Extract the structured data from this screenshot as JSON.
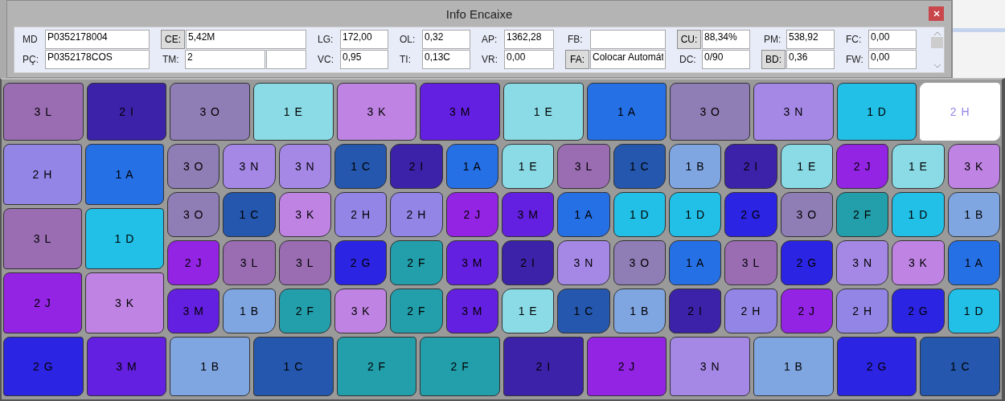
{
  "window": {
    "title": "Info Encaixe"
  },
  "field_columns": [
    [
      {
        "kind": "label",
        "label": "MD",
        "value": "P0352178004"
      },
      {
        "kind": "label",
        "label": "PÇ:",
        "value": "P0352178COS"
      }
    ],
    [
      {
        "kind": "button",
        "label": "CE:",
        "value": "5,42M"
      },
      {
        "kind": "label",
        "label": "TM:",
        "value": "2"
      }
    ],
    [
      {
        "kind": "label",
        "label": "LG:",
        "value": "172,00"
      },
      {
        "kind": "label",
        "label": "VC:",
        "value": "0,95"
      }
    ],
    [
      {
        "kind": "label",
        "label": "OL:",
        "value": "0,32"
      },
      {
        "kind": "label",
        "label": "TI:",
        "value": "0,13C"
      }
    ],
    [
      {
        "kind": "label",
        "label": "AP:",
        "value": "1362,28"
      },
      {
        "kind": "label",
        "label": "VR:",
        "value": "0,00"
      }
    ],
    [
      {
        "kind": "label",
        "label": "FB:"
      },
      {
        "kind": "button",
        "label": "FA:",
        "value": "Colocar Automát"
      }
    ],
    [
      {
        "kind": "button",
        "label": "CU:",
        "value": "88,34%"
      },
      {
        "kind": "label",
        "label": "DC:",
        "value": "0/90"
      }
    ],
    [
      {
        "kind": "label",
        "label": "PM:",
        "value": "538,92"
      },
      {
        "kind": "button",
        "label": "BD:",
        "value": "0,36"
      }
    ],
    [
      {
        "kind": "label",
        "label": "FC:",
        "value": "0,00"
      },
      {
        "kind": "label",
        "label": "FW:",
        "value": "0,00"
      }
    ]
  ],
  "marker": {
    "top_row": [
      {
        "label": "3 L",
        "color": "#9a6db3",
        "selected": false
      },
      {
        "label": "2 I",
        "color": "#3b22a8",
        "selected": false
      },
      {
        "label": "3 O",
        "color": "#8f7db5",
        "selected": false
      },
      {
        "label": "1 E",
        "color": "#8adbe6",
        "selected": false
      },
      {
        "label": "3 K",
        "color": "#bf84e3",
        "selected": false
      },
      {
        "label": "3 M",
        "color": "#6420e0",
        "selected": false
      },
      {
        "label": "1 E",
        "color": "#8adbe6",
        "selected": false
      },
      {
        "label": "1 A",
        "color": "#2670e6",
        "selected": false
      },
      {
        "label": "3 O",
        "color": "#8f7db5",
        "selected": false
      },
      {
        "label": "3 N",
        "color": "#a588e6",
        "selected": false
      },
      {
        "label": "1 D",
        "color": "#22bfe6",
        "selected": false
      },
      {
        "label": "2 H",
        "color": "#9385e6",
        "selected": true
      }
    ],
    "left_columns": [
      [
        {
          "label": "2 H",
          "color": "#9385e6",
          "selected": false
        },
        {
          "label": "3 L",
          "color": "#9a6db3",
          "selected": false
        },
        {
          "label": "2 J",
          "color": "#9324e3",
          "selected": false
        }
      ],
      [
        {
          "label": "1 A",
          "color": "#2670e6",
          "selected": false
        },
        {
          "label": "1 D",
          "color": "#22bfe6",
          "selected": false
        },
        {
          "label": "3 K",
          "color": "#bf84e3",
          "selected": false
        }
      ]
    ],
    "middle_rows": [
      [
        {
          "label": "3 O",
          "color": "#8f7db5",
          "selected": false
        },
        {
          "label": "3 N",
          "color": "#a588e6",
          "selected": false
        },
        {
          "label": "3 N",
          "color": "#a588e6",
          "selected": false
        },
        {
          "label": "1 C",
          "color": "#2457ad",
          "selected": false
        },
        {
          "label": "2 I",
          "color": "#3b22a8",
          "selected": false
        },
        {
          "label": "1 A",
          "color": "#2670e6",
          "selected": false
        },
        {
          "label": "1 E",
          "color": "#8adbe6",
          "selected": false
        },
        {
          "label": "3 L",
          "color": "#9a6db3",
          "selected": false
        },
        {
          "label": "1 C",
          "color": "#2457ad",
          "selected": false
        },
        {
          "label": "1 B",
          "color": "#80a6e2",
          "selected": false
        },
        {
          "label": "2 I",
          "color": "#3b22a8",
          "selected": false
        },
        {
          "label": "1 E",
          "color": "#8adbe6",
          "selected": false
        },
        {
          "label": "2 J",
          "color": "#9324e3",
          "selected": false
        },
        {
          "label": "1 E",
          "color": "#8adbe6",
          "selected": false
        },
        {
          "label": "3 K",
          "color": "#bf84e3",
          "selected": false
        }
      ],
      [
        {
          "label": "3 O",
          "color": "#8f7db5",
          "selected": false
        },
        {
          "label": "1 C",
          "color": "#2457ad",
          "selected": false
        },
        {
          "label": "3 K",
          "color": "#bf84e3",
          "selected": false
        },
        {
          "label": "2 H",
          "color": "#9385e6",
          "selected": false
        },
        {
          "label": "2 H",
          "color": "#9385e6",
          "selected": false
        },
        {
          "label": "2 J",
          "color": "#9324e3",
          "selected": false
        },
        {
          "label": "3 M",
          "color": "#6420e0",
          "selected": false
        },
        {
          "label": "1 A",
          "color": "#2670e6",
          "selected": false
        },
        {
          "label": "1 D",
          "color": "#22bfe6",
          "selected": false
        },
        {
          "label": "1 D",
          "color": "#22bfe6",
          "selected": false
        },
        {
          "label": "2 G",
          "color": "#2c24e3",
          "selected": false
        },
        {
          "label": "3 O",
          "color": "#8f7db5",
          "selected": false
        },
        {
          "label": "2 F",
          "color": "#229fab",
          "selected": false
        },
        {
          "label": "1 D",
          "color": "#22bfe6",
          "selected": false
        },
        {
          "label": "1 B",
          "color": "#80a6e2",
          "selected": false
        }
      ],
      [
        {
          "label": "2 J",
          "color": "#9324e3",
          "selected": false
        },
        {
          "label": "3 L",
          "color": "#9a6db3",
          "selected": false
        },
        {
          "label": "3 L",
          "color": "#9a6db3",
          "selected": false
        },
        {
          "label": "2 G",
          "color": "#2c24e3",
          "selected": false
        },
        {
          "label": "2 F",
          "color": "#229fab",
          "selected": false
        },
        {
          "label": "3 M",
          "color": "#6420e0",
          "selected": false
        },
        {
          "label": "2 I",
          "color": "#3b22a8",
          "selected": false
        },
        {
          "label": "3 N",
          "color": "#a588e6",
          "selected": false
        },
        {
          "label": "3 O",
          "color": "#8f7db5",
          "selected": false
        },
        {
          "label": "1 A",
          "color": "#2670e6",
          "selected": false
        },
        {
          "label": "3 L",
          "color": "#9a6db3",
          "selected": false
        },
        {
          "label": "2 G",
          "color": "#2c24e3",
          "selected": false
        },
        {
          "label": "3 N",
          "color": "#a588e6",
          "selected": false
        },
        {
          "label": "3 K",
          "color": "#bf84e3",
          "selected": false
        },
        {
          "label": "1 A",
          "color": "#2670e6",
          "selected": false
        }
      ],
      [
        {
          "label": "3 M",
          "color": "#6420e0",
          "selected": false
        },
        {
          "label": "1 B",
          "color": "#80a6e2",
          "selected": false
        },
        {
          "label": "2 F",
          "color": "#229fab",
          "selected": false
        },
        {
          "label": "3 K",
          "color": "#bf84e3",
          "selected": false
        },
        {
          "label": "2 F",
          "color": "#229fab",
          "selected": false
        },
        {
          "label": "3 M",
          "color": "#6420e0",
          "selected": false
        },
        {
          "label": "1 E",
          "color": "#8adbe6",
          "selected": false
        },
        {
          "label": "1 C",
          "color": "#2457ad",
          "selected": false
        },
        {
          "label": "1 B",
          "color": "#80a6e2",
          "selected": false
        },
        {
          "label": "2 I",
          "color": "#3b22a8",
          "selected": false
        },
        {
          "label": "2 H",
          "color": "#9385e6",
          "selected": false
        },
        {
          "label": "2 J",
          "color": "#9324e3",
          "selected": false
        },
        {
          "label": "2 H",
          "color": "#9385e6",
          "selected": false
        },
        {
          "label": "2 G",
          "color": "#2c24e3",
          "selected": false
        },
        {
          "label": "1 D",
          "color": "#22bfe6",
          "selected": false
        }
      ]
    ],
    "bottom_row": [
      {
        "label": "2 G",
        "color": "#2c24e3",
        "selected": false
      },
      {
        "label": "3 M",
        "color": "#6420e0",
        "selected": false
      },
      {
        "label": "1 B",
        "color": "#80a6e2",
        "selected": false
      },
      {
        "label": "1 C",
        "color": "#2457ad",
        "selected": false
      },
      {
        "label": "2 F",
        "color": "#229fab",
        "selected": false
      },
      {
        "label": "2 F",
        "color": "#229fab",
        "selected": false
      },
      {
        "label": "2 I",
        "color": "#3b22a8",
        "selected": false
      },
      {
        "label": "2 J",
        "color": "#9324e3",
        "selected": false
      },
      {
        "label": "3 N",
        "color": "#a588e6",
        "selected": false
      },
      {
        "label": "1 B",
        "color": "#80a6e2",
        "selected": false
      },
      {
        "label": "2 G",
        "color": "#2c24e3",
        "selected": false
      },
      {
        "label": "1 C",
        "color": "#2457ad",
        "selected": false
      }
    ]
  }
}
